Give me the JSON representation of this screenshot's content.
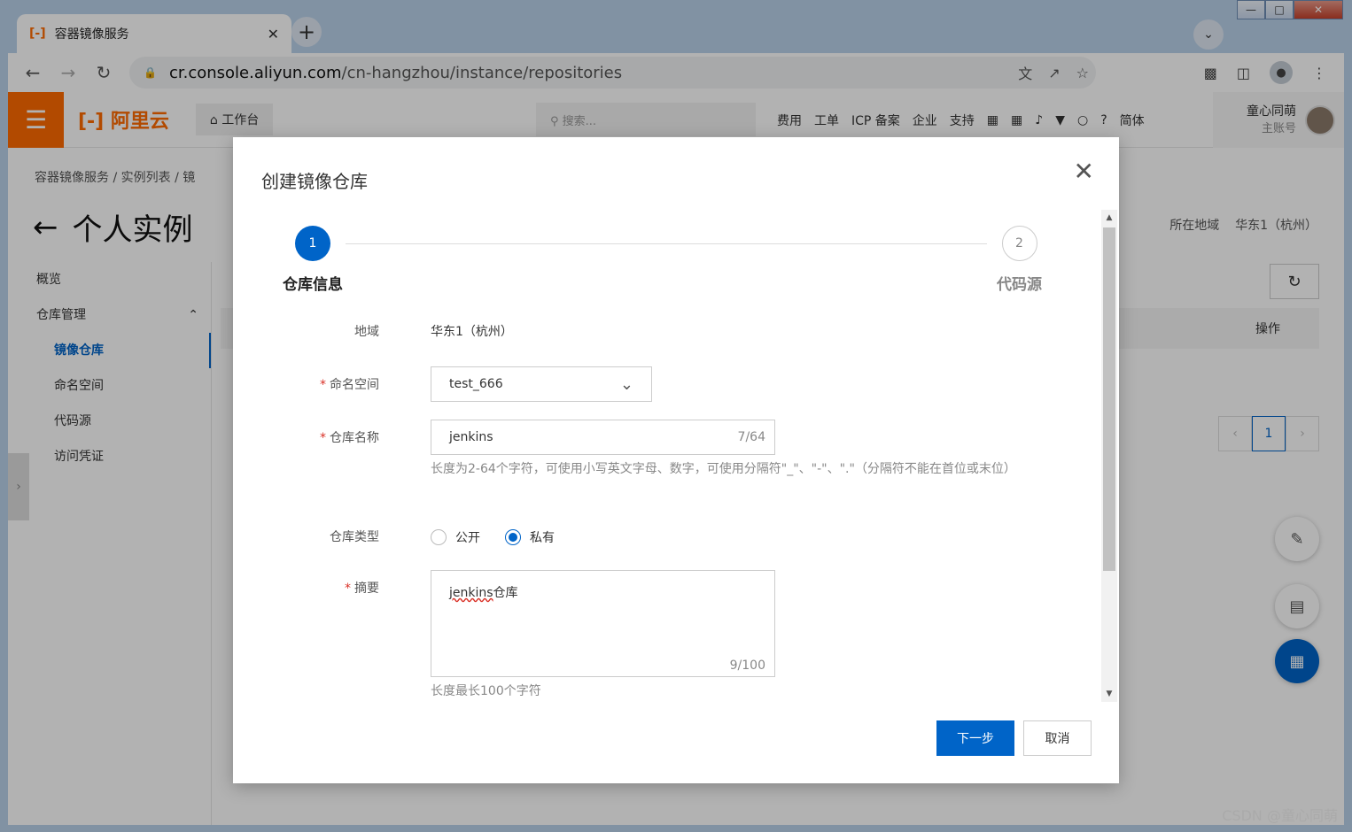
{
  "browser": {
    "tab_title": "容器镜像服务",
    "url_host": "cr.console.aliyun.com",
    "url_path": "/cn-hangzhou/instance/repositories"
  },
  "topbar": {
    "logo": "阿里云",
    "workbench": "工作台",
    "search_placeholder": "搜索...",
    "links": [
      "费用",
      "工单",
      "ICP 备案",
      "企业",
      "支持"
    ],
    "lang": "简体",
    "user_name": "童心同萌",
    "user_role": "主账号"
  },
  "page": {
    "breadcrumb": [
      "容器镜像服务",
      "/",
      "实例列表",
      "/",
      "镜"
    ],
    "title": "个人实例",
    "region_label": "所在地域",
    "region_value": "华东1（杭州）",
    "table_action_header": "操作",
    "current_page": "1"
  },
  "sidebar": {
    "items": [
      {
        "label": "概览"
      },
      {
        "label": "仓库管理"
      },
      {
        "label": "镜像仓库"
      },
      {
        "label": "命名空间"
      },
      {
        "label": "代码源"
      },
      {
        "label": "访问凭证"
      }
    ]
  },
  "dialog": {
    "title": "创建镜像仓库",
    "steps": [
      {
        "num": "1",
        "label": "仓库信息"
      },
      {
        "num": "2",
        "label": "代码源"
      }
    ],
    "region_label": "地域",
    "region_value": "华东1（杭州）",
    "namespace_label": "命名空间",
    "namespace_value": "test_666",
    "repo_name_label": "仓库名称",
    "repo_name_value": "jenkins",
    "repo_name_counter": "7/64",
    "repo_name_help": "长度为2-64个字符，可使用小写英文字母、数字，可使用分隔符\"_\"、\"-\"、\".\"（分隔符不能在首位或末位）",
    "repo_type_label": "仓库类型",
    "repo_type_public": "公开",
    "repo_type_private": "私有",
    "summary_label": "摘要",
    "summary_value_a": "jenkins",
    "summary_value_b": "仓库",
    "summary_counter": "9/100",
    "summary_help": "长度最长100个字符",
    "next_button": "下一步",
    "cancel_button": "取消"
  },
  "watermark": "CSDN @童心同萌",
  "colors": {
    "brand": "#ff6a00",
    "primary": "#0064c8",
    "required": "#d93026"
  }
}
